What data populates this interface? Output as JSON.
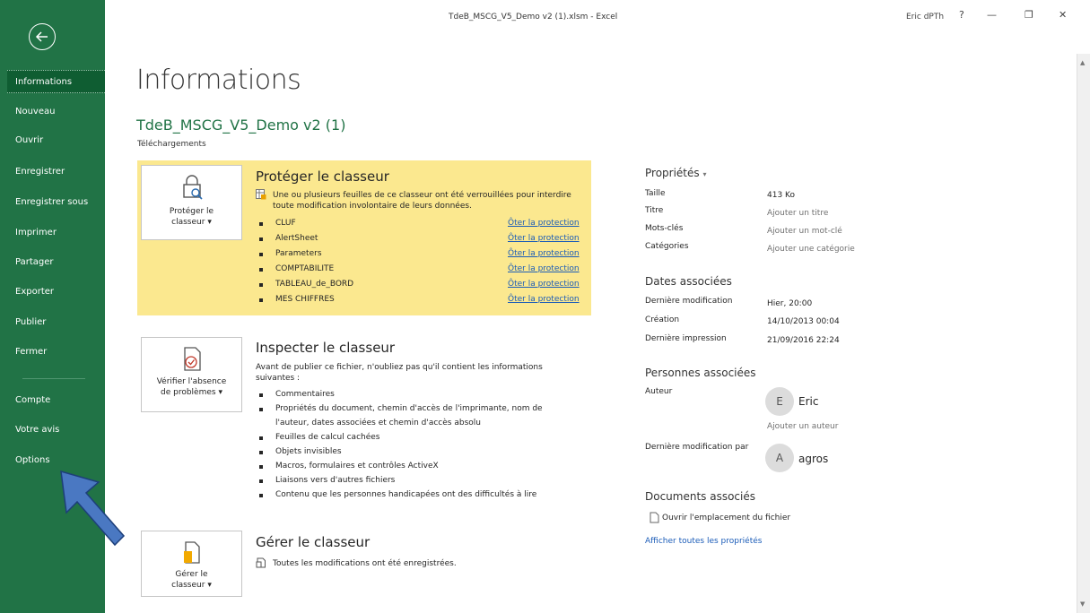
{
  "window": {
    "title": "TdeB_MSCG_V5_Demo v2 (1).xlsm  -  Excel",
    "user": "Eric dPTh",
    "help": "?",
    "minimize": "—",
    "restore": "❐",
    "close": "✕"
  },
  "sidebar": {
    "items": [
      {
        "label": "Informations"
      },
      {
        "label": "Nouveau"
      },
      {
        "label": "Ouvrir"
      },
      {
        "label": "Enregistrer"
      },
      {
        "label": "Enregistrer sous"
      },
      {
        "label": "Imprimer"
      },
      {
        "label": "Partager"
      },
      {
        "label": "Exporter"
      },
      {
        "label": "Publier"
      },
      {
        "label": "Fermer"
      },
      {
        "label": "Compte"
      },
      {
        "label": "Votre avis"
      },
      {
        "label": "Options"
      }
    ],
    "bg_color": "#217346",
    "active_color": "#0f5d32"
  },
  "main": {
    "title": "Informations",
    "file_name": "TdeB_MSCG_V5_Demo v2 (1)",
    "file_location": "Téléchargements"
  },
  "protect": {
    "button_line1": "Protéger le",
    "button_line2": "classeur",
    "title": "Protéger le classeur",
    "desc_line1": "Une ou plusieurs feuilles de ce classeur ont été verrouillées pour interdire",
    "desc_line2": "toute modification involontaire de leurs données.",
    "link_label": "Ôter la protection",
    "sheets": [
      {
        "name": "CLUF"
      },
      {
        "name": "AlertSheet"
      },
      {
        "name": "Parameters"
      },
      {
        "name": "COMPTABILITE"
      },
      {
        "name": "TABLEAU_de_BORD"
      },
      {
        "name": "MES CHIFFRES"
      }
    ],
    "panel_color": "#fbe88f"
  },
  "inspect": {
    "button_line1": "Vérifier l'absence",
    "button_line2": "de problèmes",
    "title": "Inspecter le classeur",
    "desc_line1": "Avant de publier ce fichier, n'oubliez pas qu'il contient les informations",
    "desc_line2": "suivantes :",
    "items": [
      {
        "line1": "Commentaires",
        "line2": ""
      },
      {
        "line1": "Propriétés du document, chemin d'accès de l'imprimante, nom de",
        "line2": "l'auteur, dates associées et chemin d'accès absolu"
      },
      {
        "line1": "Feuilles de calcul cachées",
        "line2": ""
      },
      {
        "line1": "Objets invisibles",
        "line2": ""
      },
      {
        "line1": "Macros, formulaires et contrôles ActiveX",
        "line2": ""
      },
      {
        "line1": "Liaisons vers d'autres fichiers",
        "line2": ""
      },
      {
        "line1": "Contenu que les personnes handicapées ont des difficultés à lire",
        "line2": ""
      }
    ]
  },
  "manage": {
    "button_line1": "Gérer le",
    "button_line2": "classeur",
    "title": "Gérer le classeur",
    "desc": "Toutes les modifications ont été enregistrées."
  },
  "properties": {
    "heading": "Propriétés",
    "rows": [
      {
        "label": "Taille",
        "value": "413 Ko"
      },
      {
        "label": "Titre",
        "value": "Ajouter un titre"
      },
      {
        "label": "Mots-clés",
        "value": "Ajouter un mot-clé"
      },
      {
        "label": "Catégories",
        "value": "Ajouter une catégorie"
      }
    ]
  },
  "dates": {
    "heading": "Dates associées",
    "rows": [
      {
        "label": "Dernière modification",
        "value": "Hier, 20:00"
      },
      {
        "label": "Création",
        "value": "14/10/2013 00:04"
      },
      {
        "label": "Dernière impression",
        "value": "21/09/2016 22:24"
      }
    ]
  },
  "people": {
    "heading": "Personnes associées",
    "author_label": "Auteur",
    "author_initial": "E",
    "author_name": "Eric",
    "add_author": "Ajouter un auteur",
    "modified_by_label": "Dernière modification par",
    "modified_by_initial": "A",
    "modified_by_name": "agros"
  },
  "documents": {
    "heading": "Documents associés",
    "open_location": "Ouvrir l'emplacement du fichier",
    "show_all": "Afficher toutes les propriétés"
  }
}
